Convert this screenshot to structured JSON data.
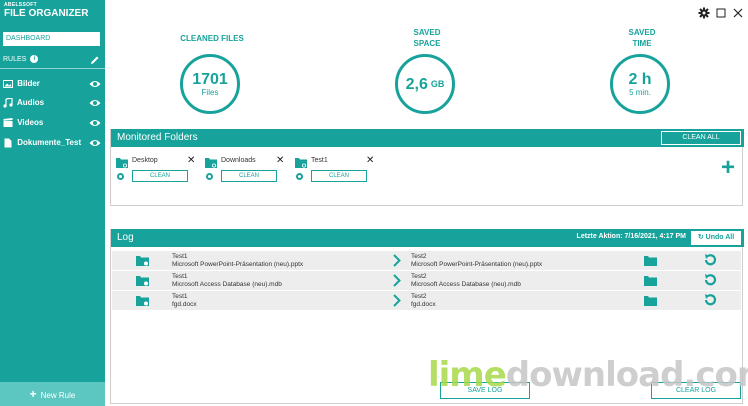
{
  "app": {
    "logo_line1": "ABELSSOFT",
    "logo_line2": "FILE ORGANIZER"
  },
  "sidebar": {
    "dashboard_label": "DASHBOARD",
    "rules_label": "RULES",
    "items": [
      {
        "label": "Bilder",
        "icon": "image-icon"
      },
      {
        "label": "Audios",
        "icon": "music-icon"
      },
      {
        "label": "Videos",
        "icon": "video-icon"
      },
      {
        "label": "Dokumente_Test",
        "icon": "document-icon"
      }
    ],
    "new_rule_label": "New Rule"
  },
  "stats": {
    "cleaned": {
      "label": "CLEANED FILES",
      "value": "1701",
      "unit": "Files"
    },
    "space": {
      "label_line1": "SAVED",
      "label_line2": "SPACE",
      "value": "2,6",
      "unit": "GB"
    },
    "time": {
      "label_line1": "SAVED",
      "label_line2": "TIME",
      "value": "2 h",
      "unit": "5 min."
    }
  },
  "monitored": {
    "title": "Monitored Folders",
    "clean_all_label": "CLEAN ALL",
    "clean_label": "CLEAN",
    "folders": [
      {
        "name": "Desktop"
      },
      {
        "name": "Downloads"
      },
      {
        "name": "Test1"
      }
    ]
  },
  "log": {
    "title": "Log",
    "last_action": "Letzte Aktion: 7/16/2021, 4:17 PM",
    "undo_all_label": "Undo All",
    "rows": [
      {
        "src_folder": "Test1",
        "src_file": "Microsoft PowerPoint-Präsentation (neu).pptx",
        "dst_folder": "Test2",
        "dst_file": "Microsoft PowerPoint-Präsentation (neu).pptx"
      },
      {
        "src_folder": "Test1",
        "src_file": "Microsoft Access Database (neu).mdb",
        "dst_folder": "Test2",
        "dst_file": "Microsoft Access Database (neu).mdb"
      },
      {
        "src_folder": "Test1",
        "src_file": "fgd.docx",
        "dst_folder": "Test2",
        "dst_file": "fgd.docx"
      }
    ],
    "save_log_label": "SAVE LOG",
    "clear_log_label": "CLEAR LOG"
  },
  "watermark": {
    "part1": "lime",
    "part2": "download.com"
  },
  "colors": {
    "accent": "#17a39b",
    "accent_light": "#5cc6c0"
  }
}
